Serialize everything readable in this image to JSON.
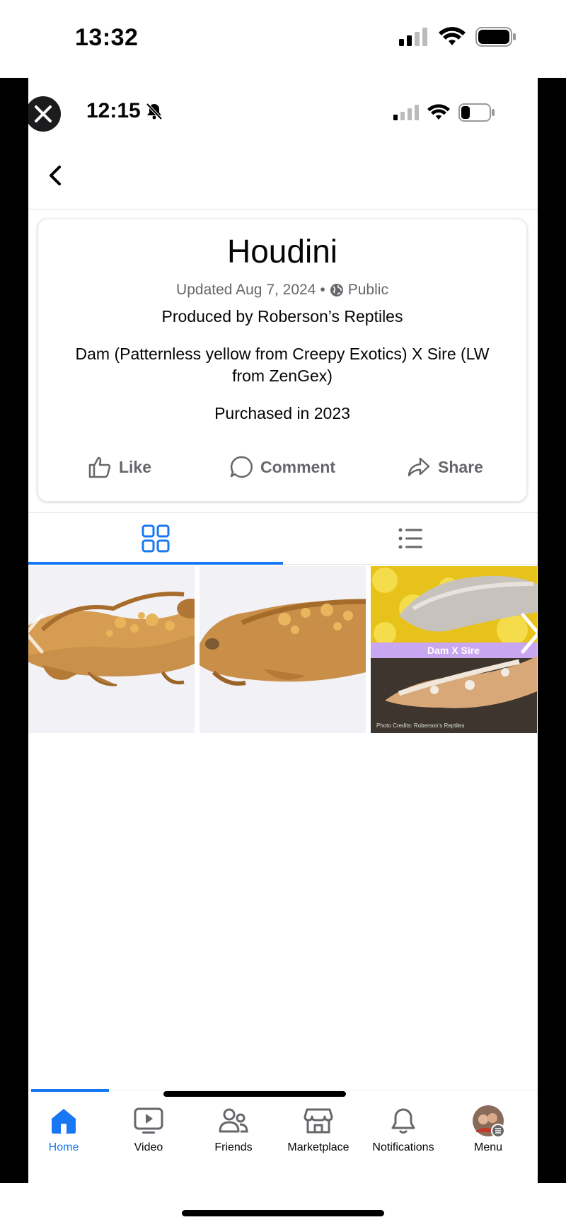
{
  "outer_status": {
    "time": "13:32"
  },
  "inner_status": {
    "time": "12:15"
  },
  "post": {
    "title": "Houdini",
    "updated": "Updated Aug 7, 2024",
    "separator": "•",
    "privacy": "Public",
    "line1": "Produced by Roberson’s Reptiles",
    "line2": "Dam (Patternless yellow from Creepy Exotics) X Sire (LW from ZenGex)",
    "line3": "Purchased in 2023"
  },
  "actions": {
    "like": "Like",
    "comment": "Comment",
    "share": "Share"
  },
  "photos": {
    "third_caption": "Dam X Sire",
    "third_credit": "Photo Credits: Roberson’s Reptiles"
  },
  "bottom_nav": [
    {
      "label": "Home",
      "icon": "home-icon",
      "active": true
    },
    {
      "label": "Video",
      "icon": "video-icon"
    },
    {
      "label": "Friends",
      "icon": "friends-icon"
    },
    {
      "label": "Marketplace",
      "icon": "marketplace-icon"
    },
    {
      "label": "Notifications",
      "icon": "bell-icon"
    },
    {
      "label": "Menu",
      "icon": "avatar"
    }
  ],
  "colors": {
    "accent": "#1877f2",
    "muted": "#65676b"
  }
}
